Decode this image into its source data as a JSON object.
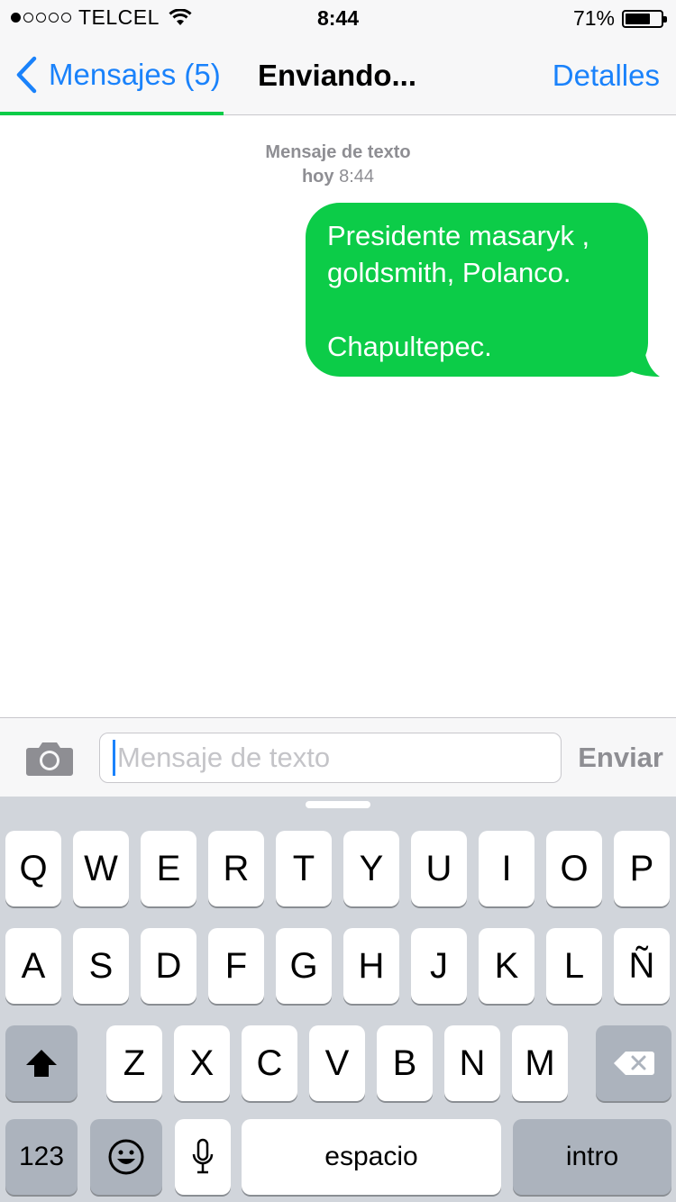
{
  "status_bar": {
    "carrier": "TELCEL",
    "signal_bars_filled": 1,
    "signal_bars_total": 5,
    "time": "8:44",
    "battery_percent": "71%",
    "battery_level": 0.71
  },
  "nav": {
    "back_label": "Mensajes (5)",
    "title": "Enviando...",
    "details_label": "Detalles",
    "send_progress": 0.33
  },
  "conversation": {
    "meta_type": "Mensaje de texto",
    "meta_day": "hoy",
    "meta_time": "8:44",
    "messages": [
      {
        "text": "Presidente masaryk ,\ngoldsmith, Polanco.\n\nChapultepec.",
        "direction": "outgoing"
      }
    ]
  },
  "composer": {
    "placeholder": "Mensaje de texto",
    "send_label": "Enviar",
    "camera_icon": "camera-icon"
  },
  "keyboard": {
    "row1": [
      "Q",
      "W",
      "E",
      "R",
      "T",
      "Y",
      "U",
      "I",
      "O",
      "P"
    ],
    "row2": [
      "A",
      "S",
      "D",
      "F",
      "G",
      "H",
      "J",
      "K",
      "L",
      "Ñ"
    ],
    "row3": [
      "Z",
      "X",
      "C",
      "V",
      "B",
      "N",
      "M"
    ],
    "numbers_label": "123",
    "space_label": "espacio",
    "return_label": "intro",
    "shift_icon": "shift-icon",
    "delete_icon": "delete-icon",
    "emoji_icon": "emoji-icon",
    "mic_icon": "microphone-icon"
  },
  "colors": {
    "accent": "#1a82fb",
    "bubble": "#0ccc48",
    "keyboard_bg": "#d1d5db",
    "dark_key": "#acb3bd"
  }
}
